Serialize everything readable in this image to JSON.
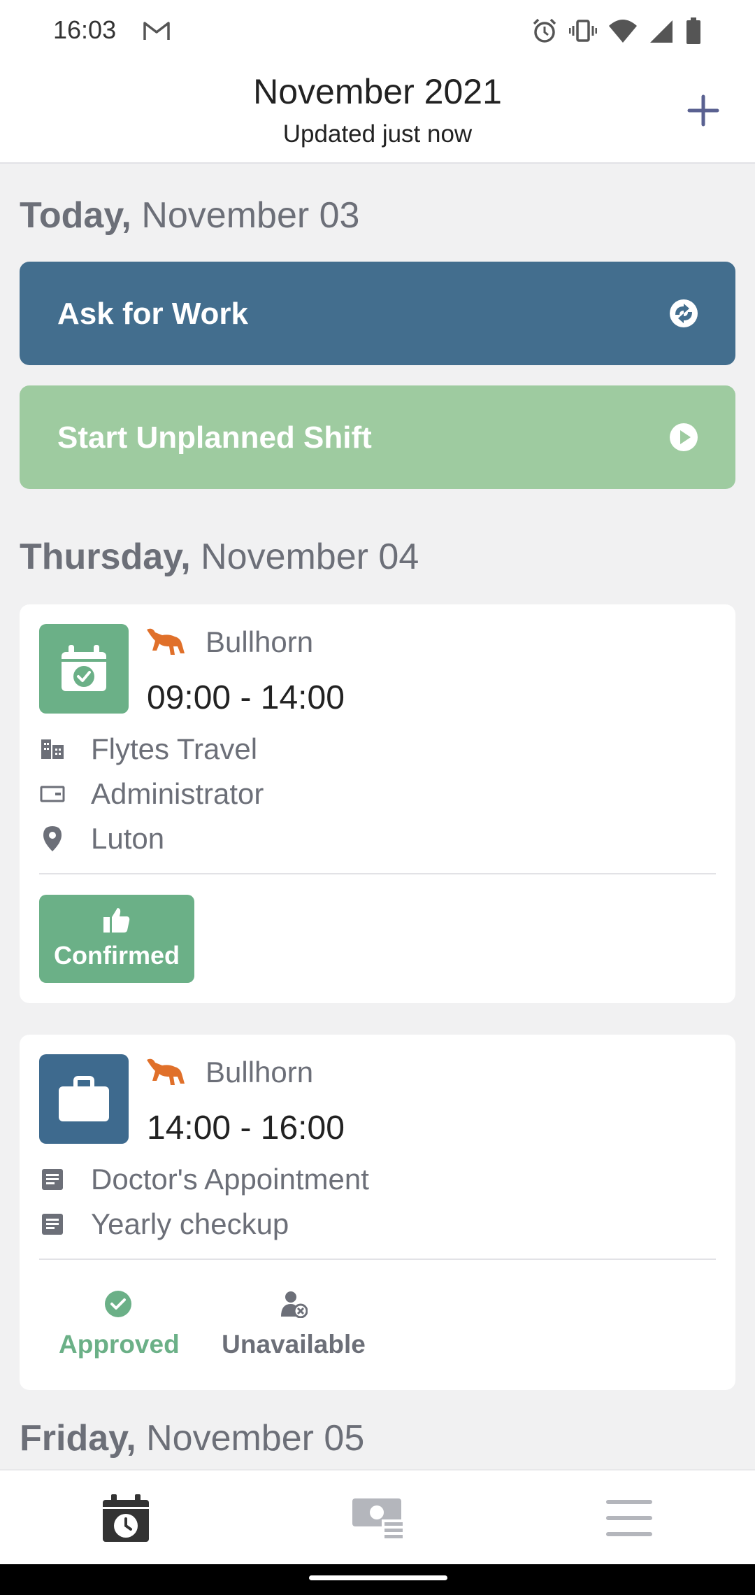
{
  "status_bar": {
    "time": "16:03",
    "icons": [
      "gmail-icon",
      "alarm-icon",
      "vibrate-icon",
      "wifi-icon",
      "signal-icon",
      "battery-icon"
    ]
  },
  "header": {
    "title": "November 2021",
    "subtitle": "Updated just now",
    "add_icon": "plus-icon"
  },
  "days": [
    {
      "weekday": "Today,",
      "date": "November 03"
    },
    {
      "weekday": "Thursday,",
      "date": "November 04"
    },
    {
      "weekday": "Friday,",
      "date": "November 05"
    }
  ],
  "actions": {
    "ask_for_work": {
      "label": "Ask for Work",
      "icon": "ask-work-icon",
      "color": "#436e8e"
    },
    "start_unplanned": {
      "label": "Start Unplanned Shift",
      "icon": "play-circle-icon",
      "color": "#9ecba0"
    }
  },
  "shifts": [
    {
      "company": "Bullhorn",
      "time": "09:00 - 14:00",
      "icon": "calendar-check-icon",
      "tile_color": "#6bb087",
      "details": [
        {
          "icon": "building-icon",
          "text": "Flytes Travel"
        },
        {
          "icon": "badge-icon",
          "text": "Administrator"
        },
        {
          "icon": "location-pin-icon",
          "text": "Luton"
        }
      ],
      "status_button": {
        "icon": "thumbs-up-icon",
        "label": "Confirmed"
      }
    },
    {
      "company": "Bullhorn",
      "time": "14:00 - 16:00",
      "icon": "briefcase-icon",
      "tile_color": "#3e6a8e",
      "details": [
        {
          "icon": "note-icon",
          "text": "Doctor's Appointment"
        },
        {
          "icon": "note-icon",
          "text": "Yearly checkup"
        }
      ],
      "statuses": [
        {
          "icon": "check-circle-icon",
          "label": "Approved",
          "color": "#6bb087"
        },
        {
          "icon": "user-unavailable-icon",
          "label": "Unavailable",
          "color": "#6c6f78"
        }
      ]
    }
  ],
  "bottom_nav": [
    {
      "name": "calendar",
      "icon": "calendar-clock-icon",
      "active": true
    },
    {
      "name": "pay",
      "icon": "pay-icon",
      "active": false
    },
    {
      "name": "menu",
      "icon": "menu-icon",
      "active": false
    }
  ]
}
